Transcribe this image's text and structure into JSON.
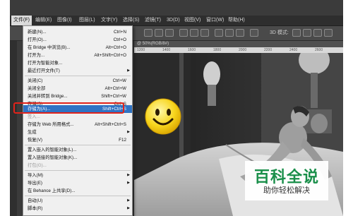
{
  "menubar": [
    "文件(F)",
    "编辑(E)",
    "图像(I)",
    "图层(L)",
    "文字(Y)",
    "选择(S)",
    "滤镜(T)",
    "3D(D)",
    "视图(V)",
    "窗口(W)",
    "帮助(H)"
  ],
  "options": {
    "mode_3d": "3D 模式:"
  },
  "document": {
    "tab_label": "@ 50%(RGB/8#)"
  },
  "ruler": [
    "1200",
    "1400",
    "1600",
    "1800",
    "2000",
    "2200",
    "2400",
    "2600"
  ],
  "file_menu": {
    "items": [
      {
        "label": "新建(N)...",
        "shortcut": "Ctrl+N"
      },
      {
        "label": "打开(O)...",
        "shortcut": "Ctrl+O"
      },
      {
        "label": "在 Bridge 中浏览(B)...",
        "shortcut": "Alt+Ctrl+O"
      },
      {
        "label": "打开为...",
        "shortcut": "Alt+Shift+Ctrl+O"
      },
      {
        "label": "打开为智能对象...",
        "shortcut": ""
      },
      {
        "label": "最近打开文件(T)",
        "shortcut": "",
        "submenu": true
      },
      {
        "label": "关闭(C)",
        "shortcut": "Ctrl+W"
      },
      {
        "label": "关闭全部",
        "shortcut": "Alt+Ctrl+W"
      },
      {
        "label": "关闭并转到 Bridge...",
        "shortcut": "Shift+Ctrl+W"
      },
      {
        "label": "存储(S)",
        "shortcut": "Ctrl+S"
      },
      {
        "label": "存储为(A)...",
        "shortcut": "Shift+Ctrl+S"
      },
      {
        "label": "签入...",
        "shortcut": ""
      },
      {
        "label": "存储为 Web 所用格式...",
        "shortcut": "Alt+Shift+Ctrl+S"
      },
      {
        "label": "生成",
        "shortcut": "",
        "submenu": true
      },
      {
        "label": "恢复(V)",
        "shortcut": "F12"
      },
      {
        "label": "置入嵌入的智能对象(L)...",
        "shortcut": ""
      },
      {
        "label": "置入链接的智能对象(K)...",
        "shortcut": ""
      },
      {
        "label": "打包(G)...",
        "shortcut": ""
      },
      {
        "label": "导入(M)",
        "shortcut": "",
        "submenu": true
      },
      {
        "label": "导出(E)",
        "shortcut": "",
        "submenu": true
      },
      {
        "label": "在 Behance 上共享(D)...",
        "shortcut": ""
      },
      {
        "label": "自动(U)",
        "shortcut": "",
        "submenu": true
      },
      {
        "label": "脚本(R)",
        "shortcut": "",
        "submenu": true
      }
    ]
  },
  "watermark": {
    "title": "百科全说",
    "subtitle": "助你轻松解决"
  },
  "colors": {
    "highlight": "#2f73c4",
    "annotation": "#e2231a",
    "watermark_green": "#1a8f4a"
  }
}
